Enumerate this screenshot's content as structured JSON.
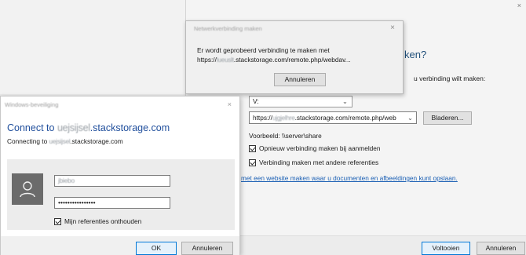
{
  "wizard": {
    "heading_fragment": "ken?",
    "instruction_fragment": "u verbinding wilt maken:",
    "drive_letter": "V:",
    "folder_value": "https://",
    "folder_value_blurred": "ujgjelhre",
    "folder_value_rest": ".stackstorage.com/remote.php/web",
    "browse_label": "Bladeren...",
    "example_text": "Voorbeeld: \\\\server\\share",
    "reconnect_label": "Opnieuw verbinding maken bij aanmelden",
    "reconnect_checked": true,
    "other_creds_label": "Verbinding maken met andere referenties",
    "other_creds_checked": true,
    "link_text": "met een website maken waar u documenten en afbeeldingen kunt opslaan.",
    "finish_label": "Voltooien",
    "cancel_label": "Annuleren"
  },
  "progress_dialog": {
    "title": "Netwerkverbinding maken",
    "line1": "Er wordt geprobeerd verbinding te maken met",
    "line2_prefix": "https://",
    "line2_blurred": "lueuslt",
    "line2_rest": ".stackstorage.com/remote.php/webdav...",
    "cancel_label": "Annuleren"
  },
  "security_dialog": {
    "title": "Windows-beveiliging",
    "heading_prefix": "Connect to ",
    "heading_blurred": "uejsijsel",
    "heading_rest": ".stackstorage.com",
    "sub_prefix": "Connecting to ",
    "sub_blurred": "uejsijsel",
    "sub_rest": ".stackstorage.com",
    "username_value": "jbiebo",
    "password_value": "••••••••••••••••",
    "remember_label": "Mijn referenties onthouden",
    "remember_checked": true,
    "ok_label": "OK",
    "cancel_label": "Annuleren"
  }
}
